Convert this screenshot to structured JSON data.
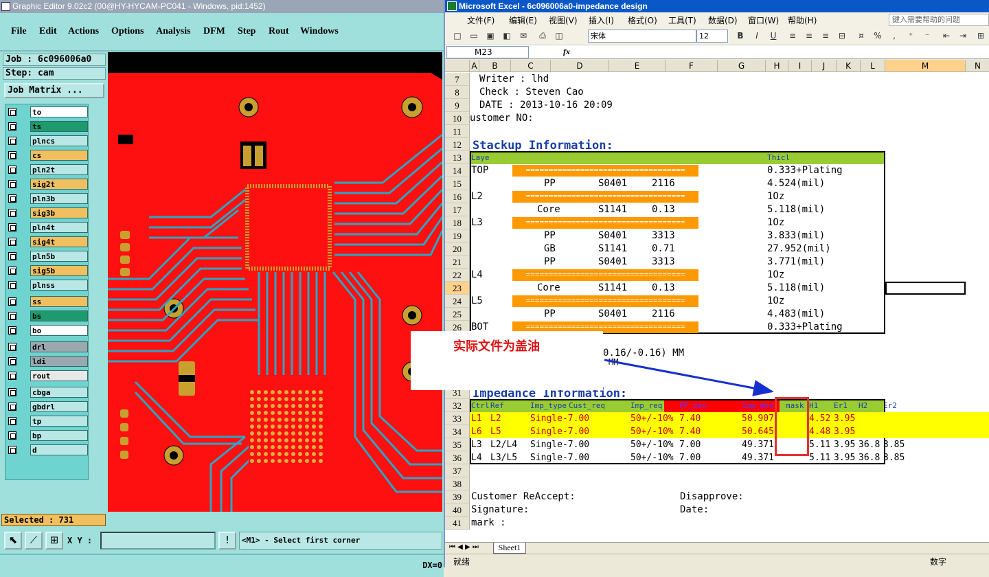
{
  "graphic_editor": {
    "title": "Graphic Editor 9.02c2 (00@HY-HYCAM-PC041 - Windows, pid:1452)",
    "menu": [
      "File",
      "Edit",
      "Actions",
      "Options",
      "Analysis",
      "DFM",
      "Step",
      "Rout",
      "Windows"
    ],
    "job_label": "Job : 6c096006a0",
    "step_label": "Step: cam",
    "job_matrix_label": "Job Matrix ...",
    "layers": [
      {
        "name": "to",
        "color": "#ffffff"
      },
      {
        "name": "ts",
        "color": "#1e9b6e"
      },
      {
        "name": "plncs",
        "color": "#b8e7e5"
      },
      {
        "name": "cs",
        "color": "#f0c060"
      },
      {
        "name": "pln2t",
        "color": "#b8e7e5"
      },
      {
        "name": "sig2t",
        "color": "#f0c060"
      },
      {
        "name": "pln3b",
        "color": "#b8e7e5"
      },
      {
        "name": "sig3b",
        "color": "#f0c060"
      },
      {
        "name": "pln4t",
        "color": "#b8e7e5"
      },
      {
        "name": "sig4t",
        "color": "#f0c060"
      },
      {
        "name": "pln5b",
        "color": "#b8e7e5"
      },
      {
        "name": "sig5b",
        "color": "#f0c060"
      },
      {
        "name": "plnss",
        "color": "#b8e7e5"
      },
      {
        "name": "ss",
        "color": "#f0c060"
      },
      {
        "name": "bs",
        "color": "#1e9b6e"
      },
      {
        "name": "bo",
        "color": "#ffffff"
      },
      {
        "name": "drl",
        "color": "#9aa8b0"
      },
      {
        "name": "ldi",
        "color": "#9aa8b0"
      },
      {
        "name": "rout",
        "color": "#e8e8e8"
      },
      {
        "name": "cbga",
        "color": "#b8e7e5"
      },
      {
        "name": "gbdrl",
        "color": "#b8e7e5"
      },
      {
        "name": "tp",
        "color": "#b8e7e5"
      },
      {
        "name": "bp",
        "color": "#b8e7e5"
      },
      {
        "name": "d",
        "color": "#b8e7e5"
      }
    ],
    "selected_label": "Selected : 731",
    "xy_label": "X Y :",
    "prompt": "<M1> - Select first corner",
    "status_dx": "DX=0",
    "colors": {
      "board": "#ff1010",
      "trace": "#2aa6c4",
      "pad": "#c8a030"
    }
  },
  "excel": {
    "title": "Microsoft Excel - 6c096006a0-impedance design",
    "menu": [
      "文件(F)",
      "编辑(E)",
      "视图(V)",
      "插入(I)",
      "格式(O)",
      "工具(T)",
      "数据(D)",
      "窗口(W)",
      "帮助(H)"
    ],
    "help_placeholder": "键入需要帮助的问题",
    "font_name": "宋体",
    "font_size": "12",
    "name_box": "M23",
    "fx": "fx",
    "columns": [
      "A",
      "B",
      "C",
      "D",
      "E",
      "F",
      "G",
      "H",
      "I",
      "J",
      "K",
      "L",
      "M",
      "N"
    ],
    "rows": [
      "7",
      "8",
      "9",
      "10",
      "11",
      "12",
      "13",
      "14",
      "15",
      "16",
      "17",
      "18",
      "19",
      "20",
      "21",
      "22",
      "23",
      "24",
      "25",
      "26",
      "27",
      "28",
      "29",
      "30",
      "31",
      "32",
      "33",
      "34",
      "35",
      "36",
      "37",
      "38",
      "39",
      "40",
      "41"
    ],
    "header_info": {
      "writer": "Writer : lhd",
      "check": "Check  : Steven Cao",
      "date": "DATE   : 2013-10-16 20:09",
      "customer": "ustomer NO:"
    },
    "stackup_title": "Stackup Information:",
    "stackup_header": {
      "layer": "Laye",
      "thick": "Thicl"
    },
    "stackup_rows": [
      {
        "layer": "TOP",
        "c": "",
        "d": "",
        "e": "",
        "thick": "0.333+Plating",
        "bar": true
      },
      {
        "layer": "",
        "c": "PP",
        "d": "S0401",
        "e": "2116",
        "thick": "4.524(mil)",
        "bar": false
      },
      {
        "layer": "L2",
        "c": "",
        "d": "",
        "e": "",
        "thick": "1Oz",
        "bar": true
      },
      {
        "layer": "",
        "c": "Core",
        "d": "S1141",
        "e": "0.13",
        "thick": "5.118(mil)",
        "bar": false
      },
      {
        "layer": "L3",
        "c": "",
        "d": "",
        "e": "",
        "thick": "1Oz",
        "bar": true
      },
      {
        "layer": "",
        "c": "PP",
        "d": "S0401",
        "e": "3313",
        "thick": "3.833(mil)",
        "bar": false
      },
      {
        "layer": "",
        "c": "GB",
        "d": "S1141",
        "e": "0.71",
        "thick": "27.952(mil)",
        "bar": false
      },
      {
        "layer": "",
        "c": "PP",
        "d": "S0401",
        "e": "3313",
        "thick": "3.771(mil)",
        "bar": false
      },
      {
        "layer": "L4",
        "c": "",
        "d": "",
        "e": "",
        "thick": "1Oz",
        "bar": true
      },
      {
        "layer": "",
        "c": "Core",
        "d": "S1141",
        "e": "0.13",
        "thick": "5.118(mil)",
        "bar": false
      },
      {
        "layer": "L5",
        "c": "",
        "d": "",
        "e": "",
        "thick": "1Oz",
        "bar": true
      },
      {
        "layer": "",
        "c": "PP",
        "d": "S0401",
        "e": "2116",
        "thick": "4.483(mil)",
        "bar": false
      },
      {
        "layer": "BOT",
        "c": "",
        "d": "",
        "e": "",
        "thick": "0.333+Plating",
        "bar": true
      }
    ],
    "bar_text": "===================================",
    "tolerance_text": "0.16/-0.16) MM",
    "mm_text": "MM",
    "impedance_title": "Impedance Information:",
    "imp_header": [
      "Ctrl",
      "Ref",
      "Imp_type",
      "Cust_req",
      "Imp_req",
      "PP_des",
      "Imp_des",
      "mask",
      "H1",
      "Er1",
      "H2",
      "Er2"
    ],
    "imp_rows": [
      {
        "ctrl": "L1",
        "ref": "L2",
        "type": "Single-",
        "cust": "7.00",
        "req": "50+/-10%",
        "pp": "7.40",
        "des": "50.907",
        "mask": "",
        "h1": "4.52",
        "er1": "3.95",
        "h2": "",
        "er2": "",
        "hl": true
      },
      {
        "ctrl": "L6",
        "ref": "L5",
        "type": "Single-",
        "cust": "7.00",
        "req": "50+/-10%",
        "pp": "7.40",
        "des": "50.645",
        "mask": "",
        "h1": "4.48",
        "er1": "3.95",
        "h2": "",
        "er2": "",
        "hl": true
      },
      {
        "ctrl": "L3",
        "ref": "L2/L4",
        "type": "Single-",
        "cust": "7.00",
        "req": "50+/-10%",
        "pp": "7.00",
        "des": "49.371",
        "mask": "",
        "h1": "5.11",
        "er1": "3.95",
        "h2": "36.8",
        "er2": "3.85",
        "hl": false
      },
      {
        "ctrl": "L4",
        "ref": "L3/L5",
        "type": "Single-",
        "cust": "7.00",
        "req": "50+/-10%",
        "pp": "7.00",
        "des": "49.371",
        "mask": "",
        "h1": "5.11",
        "er1": "3.95",
        "h2": "36.8",
        "er2": "3.85",
        "hl": false
      }
    ],
    "footer": {
      "customer_accept": "Customer RеAccept:",
      "disapprove": "Disapprove:",
      "signature": "Signature:",
      "date": "Date:",
      "mark": "mark :"
    },
    "sheet_tab": "Sheet1",
    "status_ready": "就绪",
    "status_num": "数字"
  },
  "annotation": {
    "text": "实际文件为盖油",
    "color": "#e01010"
  }
}
